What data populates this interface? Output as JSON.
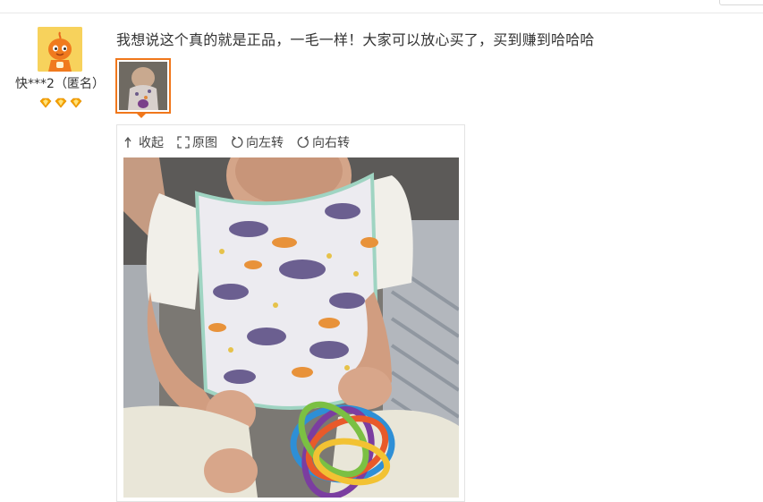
{
  "user": {
    "name": "快***2（匿名）",
    "avatar_icon": "mascot-avatar-icon",
    "rank_icons": [
      "diamond-icon",
      "diamond-icon",
      "diamond-icon"
    ],
    "rank_color": "#f5a300"
  },
  "review": {
    "text": "我想说这个真的就是正品，一毛一样！大家可以放心买了，买到赚到哈哈哈"
  },
  "viewer": {
    "toolbar": {
      "collapse_label": "收起",
      "original_label": "原图",
      "rotate_left_label": "向左转",
      "rotate_right_label": "向右转"
    }
  },
  "colors": {
    "accent": "#f0771b",
    "text": "#333333"
  }
}
